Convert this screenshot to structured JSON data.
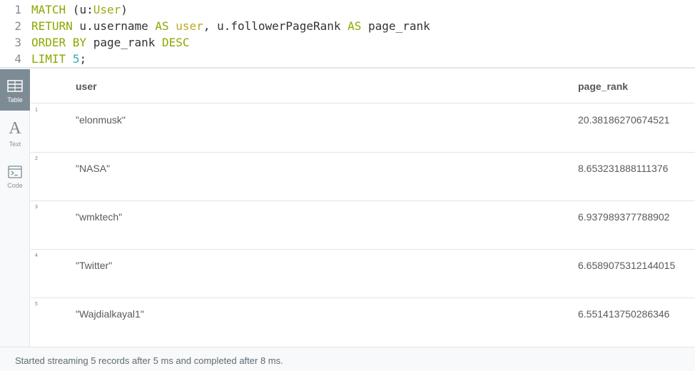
{
  "editor": {
    "lines": [
      {
        "no": "1",
        "tokens": [
          {
            "t": "MATCH",
            "c": "kw"
          },
          {
            "t": " (u:",
            "c": "plain"
          },
          {
            "t": "User",
            "c": "lbl"
          },
          {
            "t": ")",
            "c": "plain"
          }
        ]
      },
      {
        "no": "2",
        "tokens": [
          {
            "t": "RETURN",
            "c": "kw"
          },
          {
            "t": " u.username ",
            "c": "plain"
          },
          {
            "t": "AS",
            "c": "kw"
          },
          {
            "t": " ",
            "c": "plain"
          },
          {
            "t": "user",
            "c": "var"
          },
          {
            "t": ", u.followerPageRank ",
            "c": "plain"
          },
          {
            "t": "AS",
            "c": "kw"
          },
          {
            "t": " page_rank",
            "c": "plain"
          }
        ]
      },
      {
        "no": "3",
        "tokens": [
          {
            "t": "ORDER BY",
            "c": "kw"
          },
          {
            "t": " page_rank ",
            "c": "plain"
          },
          {
            "t": "DESC",
            "c": "kw"
          }
        ]
      },
      {
        "no": "4",
        "tokens": [
          {
            "t": "LIMIT",
            "c": "kw"
          },
          {
            "t": " ",
            "c": "plain"
          },
          {
            "t": "5",
            "c": "num"
          },
          {
            "t": ";",
            "c": "plain"
          }
        ]
      }
    ]
  },
  "views": [
    {
      "label": "Table",
      "icon": "table-icon",
      "active": true
    },
    {
      "label": "Text",
      "icon": "text-icon",
      "glyph": "A",
      "active": false
    },
    {
      "label": "Code",
      "icon": "code-icon",
      "active": false
    }
  ],
  "table": {
    "columns": [
      "user",
      "page_rank"
    ],
    "rows": [
      {
        "n": "1",
        "user": "\"elonmusk\"",
        "page_rank": "20.38186270674521"
      },
      {
        "n": "2",
        "user": "\"NASA\"",
        "page_rank": "8.653231888111376"
      },
      {
        "n": "3",
        "user": "\"wmktech\"",
        "page_rank": "6.937989377788902"
      },
      {
        "n": "4",
        "user": "\"Twitter\"",
        "page_rank": "6.6589075312144015"
      },
      {
        "n": "5",
        "user": "\"Wajdialkayal1\"",
        "page_rank": "6.551413750286346"
      }
    ]
  },
  "status": "Started streaming 5 records after 5 ms and completed after 8 ms."
}
